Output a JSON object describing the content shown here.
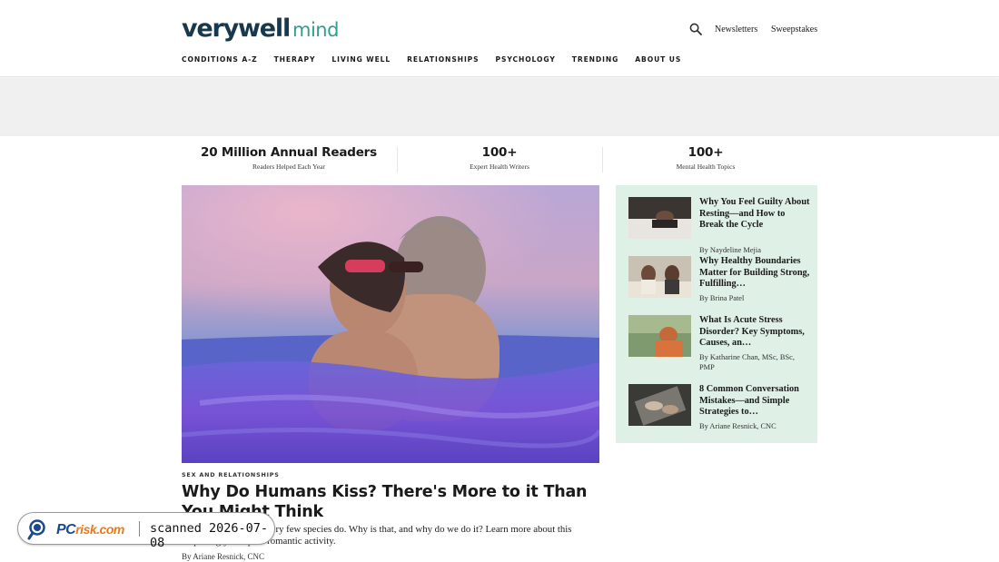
{
  "header": {
    "logo_part1": "verywell",
    "logo_part2": "mind",
    "links": [
      "Newsletters",
      "Sweepstakes"
    ],
    "search_icon": "search-icon"
  },
  "nav": {
    "items": [
      "CONDITIONS A-Z",
      "THERAPY",
      "LIVING WELL",
      "RELATIONSHIPS",
      "PSYCHOLOGY",
      "TRENDING",
      "ABOUT US"
    ]
  },
  "stats": [
    {
      "value": "20 Million Annual Readers",
      "label": "Readers Helped Each Year"
    },
    {
      "value": "100+",
      "label": "Expert Health Writers"
    },
    {
      "value": "100+",
      "label": "Mental Health Topics"
    }
  ],
  "featured": {
    "kicker": "SEX AND RELATIONSHIPS",
    "title": "Why Do Humans Kiss? There's More to it Than You Might Think",
    "description": "Kissing is something very few species do. Why is that, and why do we do it? Learn more about this surprisingly complex romantic activity.",
    "byline": "By Ariane Resnick, CNC"
  },
  "sidebar": {
    "cards": [
      {
        "title": "Why You Feel Guilty About Resting—and How to Break the Cycle",
        "byline": "By Naydeline Mejia"
      },
      {
        "title": "Why Healthy Boundaries Matter for Building Strong, Fulfilling…",
        "byline": "By Brina Patel"
      },
      {
        "title": "What Is Acute Stress Disorder? Key Symptoms, Causes, an…",
        "byline": "By Katharine Chan, MSc, BSc, PMP"
      },
      {
        "title": "8 Common Conversation Mistakes—and Simple Strategies to…",
        "byline": "By Ariane Resnick, CNC"
      }
    ]
  },
  "watermark": {
    "brand_pc": "PC",
    "brand_risk": "risk.com",
    "scanned": "scanned 2026-07-08"
  },
  "colors": {
    "logo_dark": "#17384d",
    "logo_accent": "#2e9e8f",
    "sidebar_bg": "#dff0e6"
  }
}
